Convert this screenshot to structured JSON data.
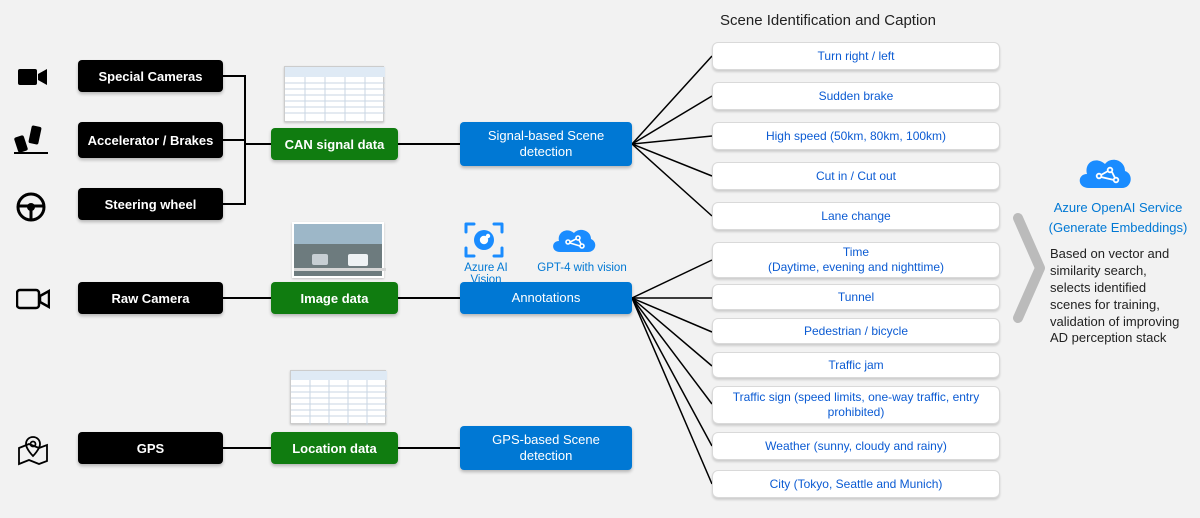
{
  "header": "Scene Identification and Caption",
  "sources": {
    "special_cameras": "Special Cameras",
    "accel_brakes": "Accelerator / Brakes",
    "steering": "Steering wheel",
    "raw_camera": "Raw Camera",
    "gps": "GPS"
  },
  "data_nodes": {
    "can": "CAN signal data",
    "image": "Image data",
    "location": "Location data"
  },
  "processors": {
    "signal": "Signal-based Scene detection",
    "annotations": "Annotations",
    "gps": "GPS-based Scene detection"
  },
  "ai_labels": {
    "vision": "Azure AI Vision",
    "gpt4v": "GPT-4 with vision"
  },
  "scenes_signal": [
    "Turn right / left",
    "Sudden brake",
    "High speed (50km, 80km, 100km)",
    "Cut in / Cut out",
    "Lane change"
  ],
  "scenes_annot": [
    "Time\n(Daytime, evening and nighttime)",
    "Tunnel",
    "Pedestrian / bicycle",
    "Traffic jam",
    "Traffic sign (speed limits, one-way traffic, entry prohibited)",
    "Weather (sunny, cloudy and rainy)",
    "City (Tokyo, Seattle and Munich)"
  ],
  "right": {
    "service": "Azure OpenAI Service",
    "caption": "(Generate Embeddings)",
    "desc": "Based on vector and similarity search, selects identified scenes for training, validation of improving AD perception stack"
  }
}
